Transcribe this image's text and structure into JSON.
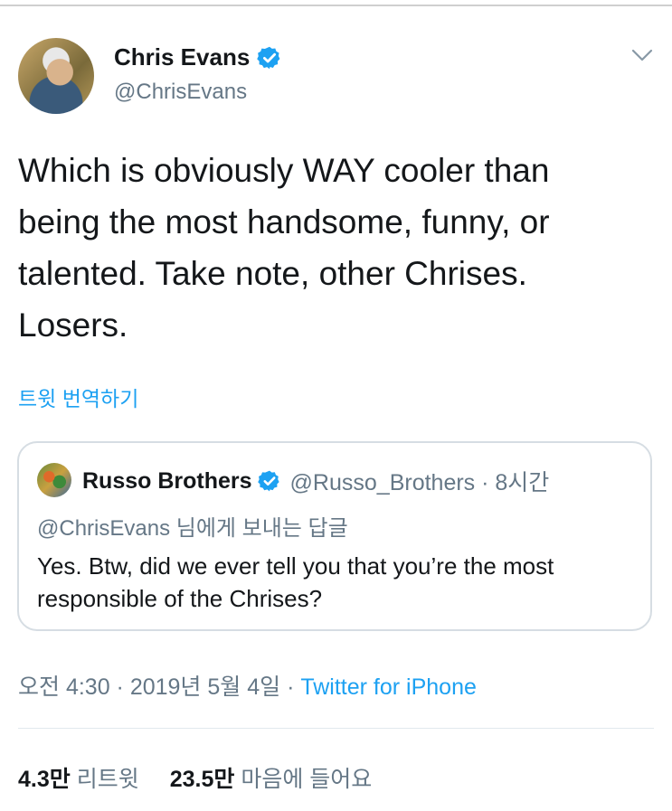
{
  "tweet": {
    "author_name": "Chris Evans",
    "author_handle": "@ChrisEvans",
    "text": "Which is obviously WAY cooler than\nbeing the most handsome, funny, or\ntalented. Take note, other Chrises.\nLosers.",
    "translate_label": "트윗 번역하기"
  },
  "quoted": {
    "author_name": "Russo Brothers",
    "handle_time": "@Russo_Brothers · 8시간",
    "reply_to": "@ChrisEvans 님에게 보내는 답글",
    "text": "Yes. Btw, did we ever tell you that you’re the most\nresponsible of the Chrises?"
  },
  "meta": {
    "time_date": "오전 4:30 · 2019년 5월 4일 · ",
    "source": "Twitter for iPhone"
  },
  "stats": {
    "retweets_count": "4.3만",
    "retweets_label": "리트윗",
    "likes_count": "23.5만",
    "likes_label": "마음에 들어요"
  },
  "colors": {
    "accent": "#1da1f2",
    "muted": "#657786",
    "text": "#14171a"
  },
  "icons": {
    "verified": "verified-badge-icon",
    "menu": "chevron-down-icon"
  }
}
